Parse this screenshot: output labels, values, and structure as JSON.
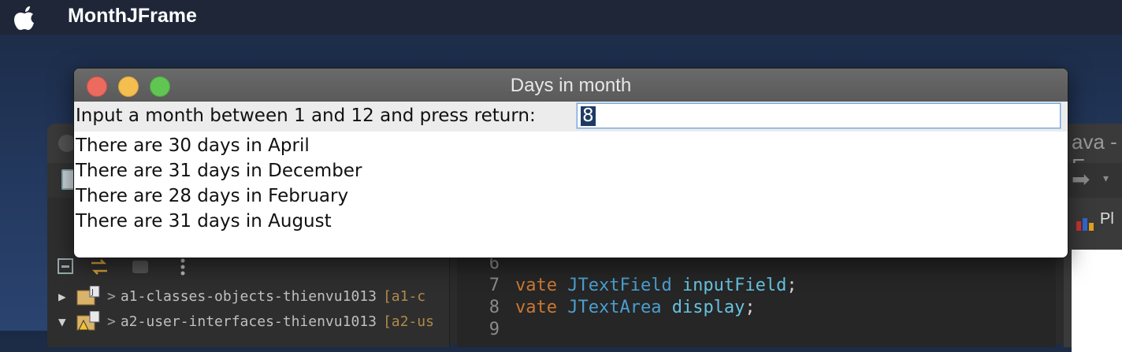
{
  "menubar": {
    "app_name": "MonthJFrame",
    "apple_icon": "apple-logo-icon"
  },
  "background_window": {
    "title_fragment": "ava - E",
    "right_tab_label": "Pl",
    "package_explorer": {
      "items": [
        {
          "arrow": "▶",
          "prefix": ">",
          "name": "a1-classes-objects-thienvu1013",
          "branch": "[a1-c"
        },
        {
          "arrow": "▼",
          "prefix": ">",
          "name": "a2-user-interfaces-thienvu1013",
          "branch": "[a2-us"
        }
      ]
    },
    "editor": {
      "lines": [
        {
          "num": "6",
          "keyword": "",
          "type": "",
          "field": "",
          "rest": ""
        },
        {
          "num": "7",
          "keyword": "vate",
          "type": "JTextField",
          "field": "inputField",
          "rest": ";"
        },
        {
          "num": "8",
          "keyword": "vate",
          "type": "JTextArea",
          "field": "display",
          "rest": ";"
        },
        {
          "num": "9",
          "keyword": "",
          "type": "",
          "field": "",
          "rest": ""
        }
      ]
    }
  },
  "dialog": {
    "title": "Days in month",
    "prompt": "Input a month between 1 and 12 and press return:",
    "input_value": "8",
    "output_lines": [
      "There are 30 days in April",
      "There are 31 days in December",
      "There are 28 days in February",
      "There are 31 days in August"
    ]
  },
  "colors": {
    "close": "#ed6a5e",
    "minimize": "#f4bf4f",
    "maximize": "#61c554",
    "selection": "#1e3a64",
    "keyword": "#cc7832",
    "type": "#4a9fd0"
  }
}
